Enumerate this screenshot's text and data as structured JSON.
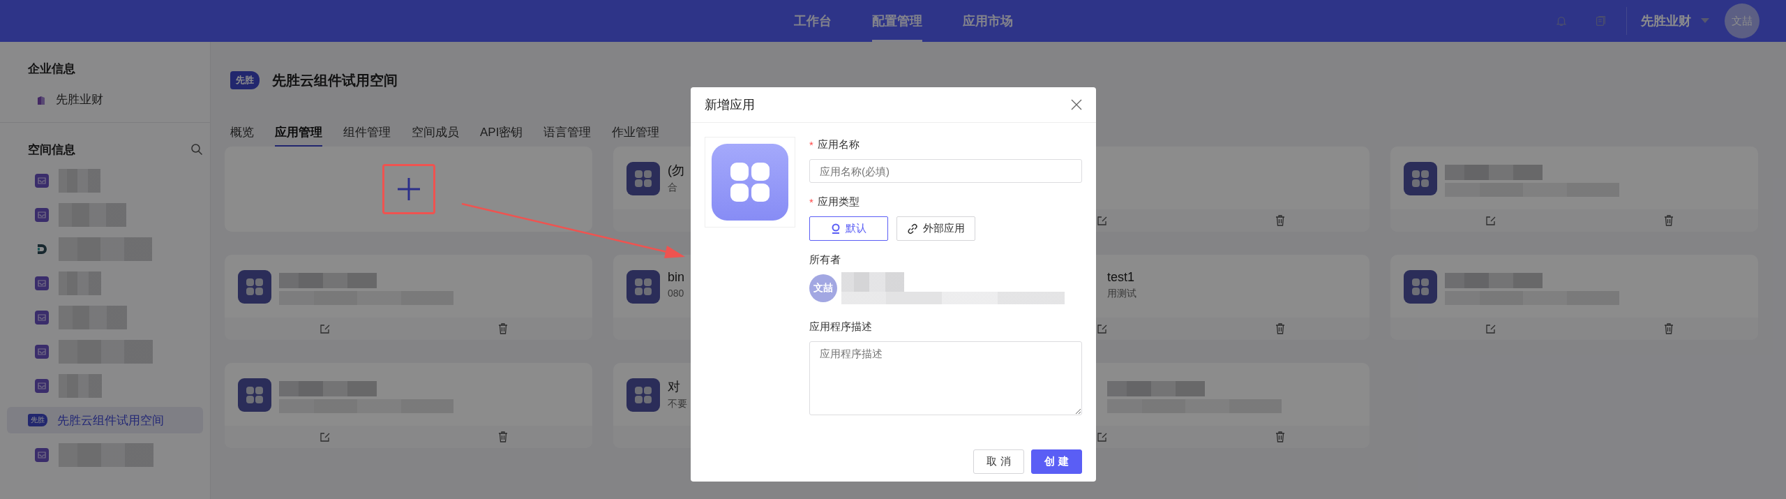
{
  "top_bar": {
    "nav": [
      {
        "label": "工作台",
        "selected": false
      },
      {
        "label": "配置管理",
        "selected": true
      },
      {
        "label": "应用市场",
        "selected": false
      }
    ],
    "org_name": "先胜业财",
    "avatar": "文喆"
  },
  "sidebar": {
    "sections": [
      {
        "title": "企业信息",
        "items": [
          {
            "kind": "org",
            "label": "先胜业财",
            "selected": false
          }
        ]
      },
      {
        "title": "空间信息",
        "items": [
          {
            "kind": "inbox",
            "selected": false
          },
          {
            "kind": "inbox",
            "selected": false
          },
          {
            "kind": "logo",
            "selected": false
          },
          {
            "kind": "inbox",
            "selected": false
          },
          {
            "kind": "inbox",
            "selected": false
          },
          {
            "kind": "inbox",
            "selected": false
          },
          {
            "kind": "inbox",
            "selected": false
          },
          {
            "kind": "badge",
            "badge": "先胜",
            "label": "先胜云组件试用空间",
            "selected": true
          },
          {
            "kind": "inbox",
            "selected": false
          }
        ]
      }
    ]
  },
  "space": {
    "badge": "先胜",
    "title": "先胜云组件试用空间"
  },
  "tabs": [
    {
      "label": "概览",
      "selected": false
    },
    {
      "label": "应用管理",
      "selected": true
    },
    {
      "label": "组件管理",
      "selected": false
    },
    {
      "label": "空间成员",
      "selected": false
    },
    {
      "label": "API密钥",
      "selected": false
    },
    {
      "label": "语言管理",
      "selected": false
    },
    {
      "label": "作业管理",
      "selected": false
    }
  ],
  "cards": [
    {
      "kind": "add"
    },
    {
      "kind": "app-covered",
      "title": "(勿",
      "subtitle": "合"
    },
    {
      "kind": "covered"
    },
    {
      "kind": "redacted"
    },
    {
      "kind": "redacted"
    },
    {
      "kind": "app-covered",
      "title": "bin",
      "subtitle": "080"
    },
    {
      "kind": "covered",
      "title": "test1",
      "subtitle": "用测试"
    },
    {
      "kind": "redacted"
    },
    {
      "kind": "redacted"
    },
    {
      "kind": "app-covered",
      "title": "对",
      "subtitle": "不要"
    },
    {
      "kind": "covered-redacted"
    }
  ],
  "dialog": {
    "title": "新增应用",
    "name_field": {
      "label": "应用名称",
      "required_mark": "*",
      "placeholder": "应用名称(必填)"
    },
    "type_field": {
      "label": "应用类型",
      "required_mark": "*",
      "options": [
        {
          "kind": "default",
          "label": "默认",
          "selected": true
        },
        {
          "kind": "link",
          "label": "外部应用",
          "selected": false
        }
      ]
    },
    "owner": {
      "label": "所有者",
      "avatar": "文喆"
    },
    "description": {
      "label": "应用程序描述",
      "placeholder": "应用程序描述"
    },
    "buttons": [
      {
        "kind": "secondary",
        "label": "取 消"
      },
      {
        "kind": "primary",
        "label": "创 建"
      }
    ]
  }
}
